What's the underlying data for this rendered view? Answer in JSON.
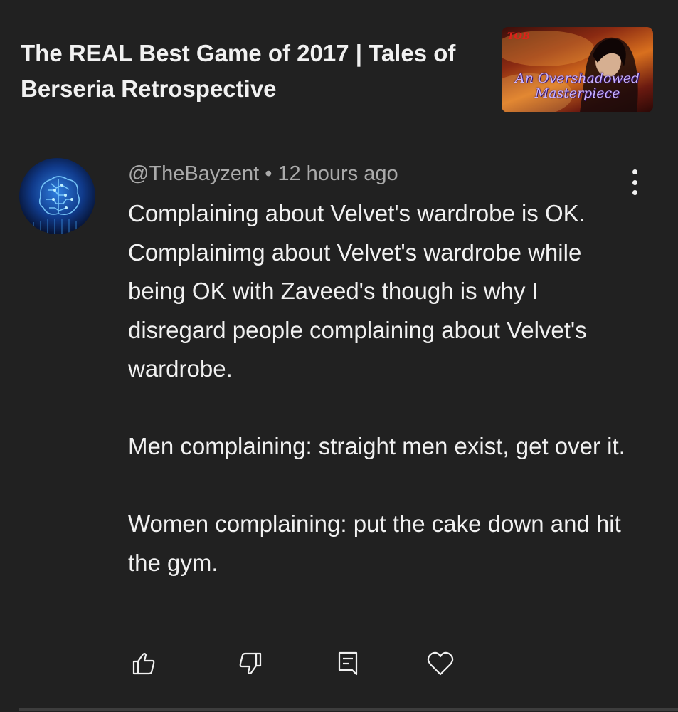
{
  "video": {
    "title": "The REAL Best Game of 2017 | Tales of Berseria Retrospective",
    "thumbnail_text": "An Overshadowed Masterpiece",
    "thumbnail_logo": "TOB"
  },
  "comment": {
    "author": "@TheBayzent",
    "separator": "•",
    "time": "12 hours ago",
    "paragraphs": [
      "Complaining about Velvet's wardrobe is OK. Complainimg about Velvet's wardrobe while being OK with Zaveed's though is why I disregard people complaining about Velvet's wardrobe.",
      "Men complaining: straight men exist, get over it.",
      "Women complaining: put the cake down and hit the gym."
    ],
    "avatar_icon": "brain-circuit-icon"
  },
  "actions": {
    "like_icon": "thumbs-up-icon",
    "dislike_icon": "thumbs-down-icon",
    "reply_icon": "reply-icon",
    "heart_icon": "heart-icon"
  },
  "colors": {
    "background": "#212121",
    "text_primary": "#f1f1f1",
    "text_secondary": "#aaaaaa"
  }
}
